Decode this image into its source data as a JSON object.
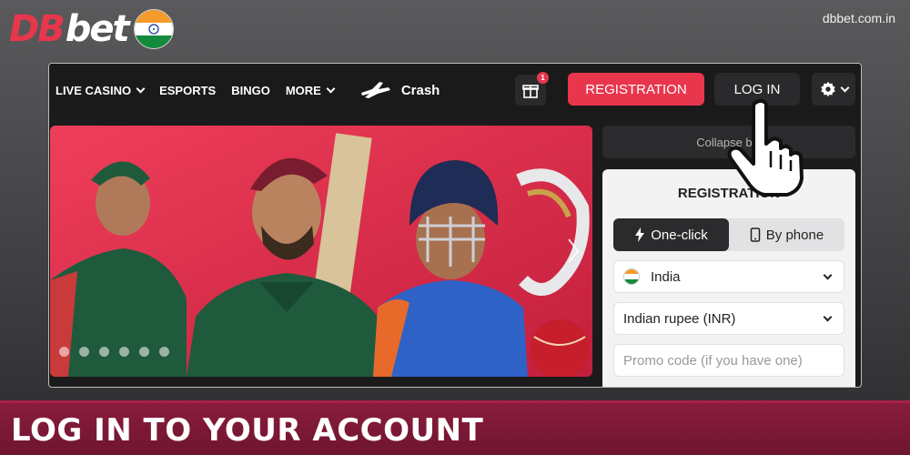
{
  "brand": {
    "logo_part1": "DB",
    "logo_part2": "bet",
    "site_url": "dbbet.com.in",
    "colors": {
      "accent": "#e8364d",
      "flag_saffron": "#f59b2b",
      "flag_green": "#148a3c",
      "chakra": "#1a3a9a"
    }
  },
  "nav": {
    "items": [
      {
        "label": "LIVE CASINO",
        "has_dropdown": true
      },
      {
        "label": "ESPORTS",
        "has_dropdown": false
      },
      {
        "label": "BINGO",
        "has_dropdown": false
      },
      {
        "label": "MORE",
        "has_dropdown": true
      }
    ],
    "crash_label": "Crash",
    "gift_badge_count": "1",
    "registration_label": "REGISTRATION",
    "login_label": "LOG IN",
    "settings_icon": "gear-icon"
  },
  "banner": {
    "slide_count": 6,
    "colors": {
      "bg": "#e8364d",
      "green_jersey": "#1f5a3c",
      "blue_jersey": "#2f62c7"
    }
  },
  "side": {
    "collapse_label": "Collapse blo",
    "registration": {
      "title": "REGISTRATION",
      "tabs": [
        {
          "label": "One-click",
          "icon": "lightning-icon",
          "active": true
        },
        {
          "label": "By phone",
          "icon": "phone-icon",
          "active": false
        }
      ],
      "country_value": "India",
      "currency_value": "Indian rupee (INR)",
      "promo_placeholder": "Promo code (if you have one)"
    }
  },
  "caption": {
    "text": "LOG IN TO YOUR ACCOUNT",
    "color": "#8a1c3c"
  }
}
